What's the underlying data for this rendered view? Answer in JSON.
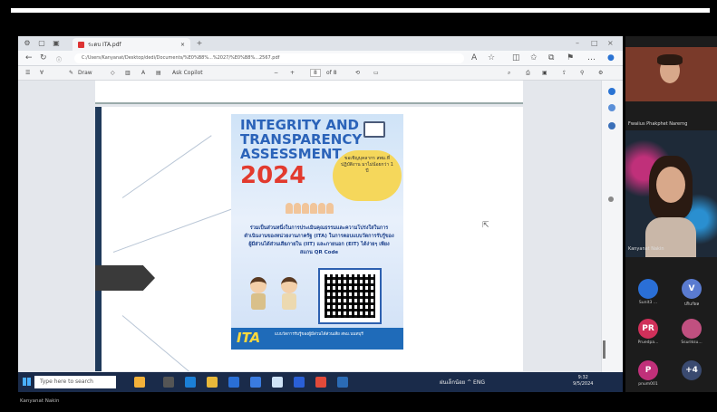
{
  "browser": {
    "tab_title": "ระดบ ITA.pdf",
    "url": "C:/Users/Kanyanat/Desktop/dedi/Documents/%E0%B8%...%2027/%E0%B8%...2567.pdf",
    "add_tab": "+",
    "window_controls": [
      "–",
      "□",
      "×"
    ]
  },
  "pdf_toolbar": {
    "draw_label": "Draw",
    "font_label": "Ask Copilot",
    "zoom_minus": "−",
    "zoom_plus": "+",
    "page_current": "8",
    "page_total": "of 8"
  },
  "poster": {
    "title_line1": "INTEGRITY AND",
    "title_line2": "TRANSPARENCY",
    "title_line3": "ASSESSMENT",
    "year": "2024",
    "badge_text": "ขอเชิญบุคลากร สพม.ที่ปฏิบัติงาน มาไม่น้อยกว่า 1 ปี",
    "description": "ร่วมเป็นส่วนหนึ่งในการประเมินคุณธรรมและความโปร่งใสในการดำเนินงานของหน่วยงานภาครัฐ (ITA) ในการตอบแบบวัดการรับรู้ของผู้มีส่วนได้ส่วนเสียภายใน (IIT) และภายนอก (EIT) ได้ง่ายๆ เพียงสแกน QR Code",
    "footer_brand": "ITA",
    "footer_text": "แบบวัดการรับรู้ของผู้มีส่วนได้ส่วนเสีย สพม.นนทบุรี"
  },
  "taskbar": {
    "search_placeholder": "Type here to search",
    "tray_text": "ฝนเล็กน้อย  ^  ENG",
    "clock_time": "9:32",
    "clock_date": "9/5/2024"
  },
  "meeting": {
    "participant1_label": "",
    "participant2_label": "Fwaiius  Phakphet Narerng",
    "participant3_label": "Kanyanat Nakin",
    "avatars": [
      {
        "initials": "",
        "label": "Sunit3 ...",
        "color": "#2a6fd6"
      },
      {
        "initials": "V",
        "label": "ปกิแก้ผล",
        "color": "#5a7bd0"
      },
      {
        "initials": "PR",
        "label": "Pruedpa...",
        "color": "#d0305a"
      },
      {
        "initials": "",
        "label": "Ssuriksu...",
        "color": "#c05080"
      },
      {
        "initials": "P",
        "label": "pnum001",
        "color": "#c0307a"
      },
      {
        "initials": "+4",
        "label": "",
        "color": "#3a4a70"
      }
    ]
  },
  "caption": "Kanyanat Nakin"
}
